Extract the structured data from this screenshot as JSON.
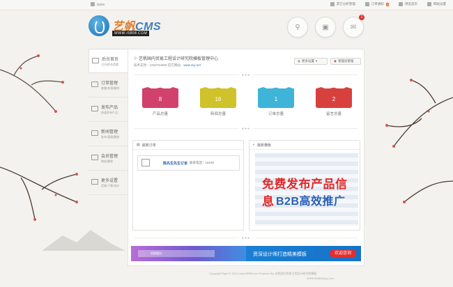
{
  "topbar": {
    "domain": "i5808",
    "links": [
      {
        "label": "其它分析管理",
        "icon": "document-icon"
      },
      {
        "label": "订单通知",
        "icon": "mail-icon",
        "badge": "3"
      },
      {
        "label": "预览首页",
        "icon": "cloud-icon"
      },
      {
        "label": "网站设置",
        "icon": "gear-icon"
      }
    ]
  },
  "logo": {
    "brand": "艺帆",
    "brand_suffix": "CMS",
    "url": "WWW.i5808.COM"
  },
  "header_buttons": [
    {
      "name": "sitemap-button",
      "icon": "sitemap-icon"
    },
    {
      "name": "truck-button",
      "icon": "truck-icon"
    },
    {
      "name": "message-button",
      "icon": "chat-icon",
      "badge": "2"
    }
  ],
  "sidebar": [
    {
      "title": "后台首页",
      "sub": "后台综合首看",
      "icon": "home-icon",
      "active": true
    },
    {
      "title": "订单管理",
      "sub": "查看/处理/删除",
      "icon": "mail-icon"
    },
    {
      "title": "发布产品",
      "sub": "快速发布产品",
      "icon": "edit-icon"
    },
    {
      "title": "新闻管理",
      "sub": "发布/管理/删除",
      "icon": "news-icon"
    },
    {
      "title": "会员管理",
      "sub": "审核/删除",
      "icon": "users-icon"
    },
    {
      "title": "更多设置",
      "sub": "定制/下载/设计",
      "icon": "chart-icon"
    }
  ],
  "site": {
    "name": "艺帆国内贸易工程设计研究院横板管理中心",
    "support_label": "技术支持：1063754960 官方网站：",
    "support_url": "www.ziyi.net"
  },
  "header_actions": {
    "more": "更多设置",
    "admin": "管理员管理"
  },
  "stats": [
    {
      "value": "8",
      "label": "产品总量",
      "color": "#d1416b"
    },
    {
      "value": "16",
      "label": "新闻总量",
      "color": "#cfc22a"
    },
    {
      "value": "1",
      "label": "订单总量",
      "color": "#3eb4d8"
    },
    {
      "value": "2",
      "label": "留言总量",
      "color": "#d8403e"
    }
  ],
  "latest_orders": {
    "title": "最新订单",
    "item_link": "陈先生先生订单",
    "item_phone": "联系电话：10100"
  },
  "latest_template": {
    "title": "最新横板",
    "ad_line1": "免费发布产品信息",
    "ad_line2": "B2B高效推广"
  },
  "banner": {
    "left_text": "艺帆股份",
    "right_text": "资深设计师打造精美模板",
    "right_pill": "欢迎咨询"
  },
  "footer": {
    "copyright": "Copyright Right © 2012 www.i5808.com Powered By 艺帆国内贸易工程设计研究院横板",
    "email": "1063754960@qq.com"
  },
  "colors": {
    "accent": "#3d7fc1",
    "brand_orange": "#e07a2b"
  }
}
